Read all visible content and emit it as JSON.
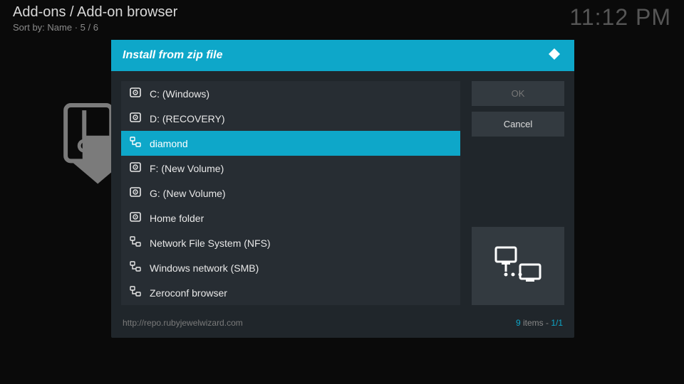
{
  "header": {
    "breadcrumb": "Add-ons / Add-on browser",
    "sortline": "Sort by: Name  ·  5 / 6",
    "clock": "11:12 PM"
  },
  "dialog": {
    "title": "Install from zip file",
    "ok_label": "OK",
    "cancel_label": "Cancel",
    "footer_url": "http://repo.rubyjewelwizard.com",
    "footer_count": "9",
    "footer_items_word": " items - ",
    "footer_page": "1/1"
  },
  "items": [
    {
      "label": "C: (Windows)",
      "icon": "hdd",
      "selected": false
    },
    {
      "label": "D: (RECOVERY)",
      "icon": "hdd",
      "selected": false
    },
    {
      "label": "diamond",
      "icon": "net",
      "selected": true
    },
    {
      "label": "F: (New Volume)",
      "icon": "hdd",
      "selected": false
    },
    {
      "label": "G: (New Volume)",
      "icon": "hdd",
      "selected": false
    },
    {
      "label": "Home folder",
      "icon": "hdd",
      "selected": false
    },
    {
      "label": "Network File System (NFS)",
      "icon": "net",
      "selected": false
    },
    {
      "label": "Windows network (SMB)",
      "icon": "net",
      "selected": false
    },
    {
      "label": "Zeroconf browser",
      "icon": "net",
      "selected": false
    }
  ]
}
